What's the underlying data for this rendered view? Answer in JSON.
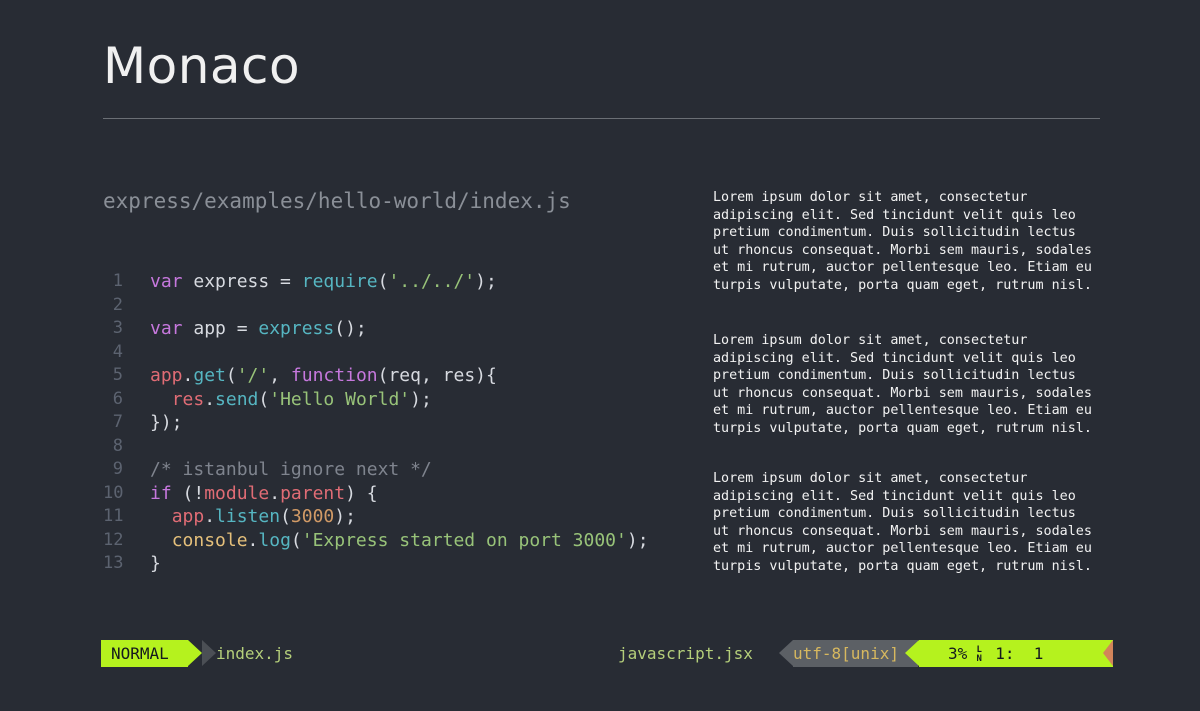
{
  "title": "Monaco",
  "file_path": "express/examples/hello-world/index.js",
  "code_lines": [
    {
      "n": "1",
      "tokens": [
        [
          "var",
          "kw"
        ],
        [
          " express = ",
          "plain"
        ],
        [
          "require",
          "fn"
        ],
        [
          "(",
          "plain"
        ],
        [
          "'../../'",
          "str"
        ],
        [
          ");",
          "plain"
        ]
      ]
    },
    {
      "n": "2",
      "tokens": []
    },
    {
      "n": "3",
      "tokens": [
        [
          "var",
          "kw"
        ],
        [
          " app = ",
          "plain"
        ],
        [
          "express",
          "fn"
        ],
        [
          "();",
          "plain"
        ]
      ]
    },
    {
      "n": "4",
      "tokens": []
    },
    {
      "n": "5",
      "tokens": [
        [
          "app",
          "var"
        ],
        [
          ".",
          "plain"
        ],
        [
          "get",
          "fn"
        ],
        [
          "(",
          "plain"
        ],
        [
          "'/'",
          "str"
        ],
        [
          ", ",
          "plain"
        ],
        [
          "function",
          "kw"
        ],
        [
          "(req, res){",
          "plain"
        ]
      ]
    },
    {
      "n": "6",
      "tokens": [
        [
          "  ",
          "plain"
        ],
        [
          "res",
          "var"
        ],
        [
          ".",
          "plain"
        ],
        [
          "send",
          "fn"
        ],
        [
          "(",
          "plain"
        ],
        [
          "'Hello World'",
          "str"
        ],
        [
          ");",
          "plain"
        ]
      ]
    },
    {
      "n": "7",
      "tokens": [
        [
          "});",
          "plain"
        ]
      ]
    },
    {
      "n": "8",
      "tokens": []
    },
    {
      "n": "9",
      "tokens": [
        [
          "/* istanbul ignore next */",
          "cmt"
        ]
      ]
    },
    {
      "n": "10",
      "tokens": [
        [
          "if",
          "kw"
        ],
        [
          " (!",
          "plain"
        ],
        [
          "module",
          "var"
        ],
        [
          ".",
          "plain"
        ],
        [
          "parent",
          "var"
        ],
        [
          ") {",
          "plain"
        ]
      ]
    },
    {
      "n": "11",
      "tokens": [
        [
          "  ",
          "plain"
        ],
        [
          "app",
          "var"
        ],
        [
          ".",
          "plain"
        ],
        [
          "listen",
          "fn"
        ],
        [
          "(",
          "plain"
        ],
        [
          "3000",
          "num"
        ],
        [
          ");",
          "plain"
        ]
      ]
    },
    {
      "n": "12",
      "tokens": [
        [
          "  ",
          "plain"
        ],
        [
          "console",
          "obj"
        ],
        [
          ".",
          "plain"
        ],
        [
          "log",
          "fn"
        ],
        [
          "(",
          "plain"
        ],
        [
          "'Express started on port 3000'",
          "str"
        ],
        [
          ");",
          "plain"
        ]
      ]
    },
    {
      "n": "13",
      "tokens": [
        [
          "}",
          "plain"
        ]
      ]
    }
  ],
  "lorem_paragraphs": [
    "Lorem ipsum dolor sit amet, consectetur\nadipiscing elit. Sed tincidunt velit quis leo\npretium condimentum. Duis sollicitudin lectus\nut rhoncus consequat. Morbi sem mauris, sodales\net mi rutrum, auctor pellentesque leo. Etiam eu\nturpis vulputate, porta quam eget, rutrum nisl.",
    "Lorem ipsum dolor sit amet, consectetur\nadipiscing elit. Sed tincidunt velit quis leo\npretium condimentum. Duis sollicitudin lectus\nut rhoncus consequat. Morbi sem mauris, sodales\net mi rutrum, auctor pellentesque leo. Etiam eu\nturpis vulputate, porta quam eget, rutrum nisl.",
    "Lorem ipsum dolor sit amet, consectetur\nadipiscing elit. Sed tincidunt velit quis leo\npretium condimentum. Duis sollicitudin lectus\nut rhoncus consequat. Morbi sem mauris, sodales\net mi rutrum, auctor pellentesque leo. Etiam eu\nturpis vulputate, porta quam eget, rutrum nisl."
  ],
  "statusbar": {
    "mode": "NORMAL",
    "file": "index.js",
    "filetype": "javascript.jsx",
    "encoding": "utf-8[unix]",
    "percent": "3%",
    "line_icon_top": "L",
    "line_icon_bottom": "N",
    "line": "1:",
    "col": "1"
  },
  "colors": {
    "background": "#282c34",
    "mode_accent": "#b5f21e",
    "keyword": "#c678dd",
    "function": "#56b6c2",
    "string": "#98c379",
    "variable": "#e06c75",
    "number": "#d19a66",
    "comment": "#7f848e"
  }
}
